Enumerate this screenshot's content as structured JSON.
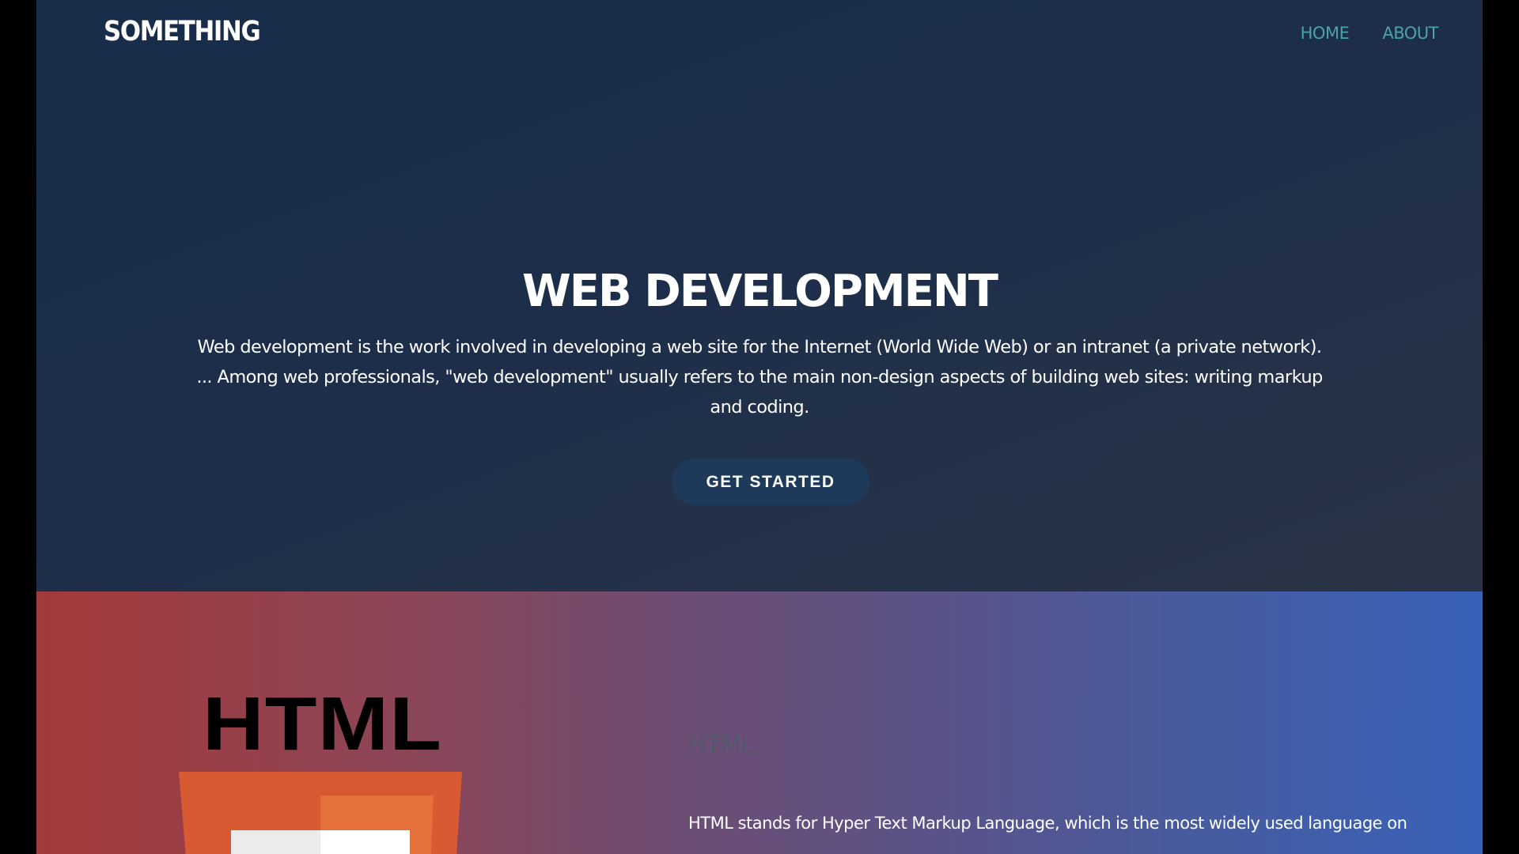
{
  "header": {
    "brand": "SOMETHING",
    "nav": [
      {
        "label": "HOME"
      },
      {
        "label": "ABOUT"
      }
    ]
  },
  "hero": {
    "title": "WEB DEVELOPMENT",
    "description": "Web development is the work involved in developing a web site for the Internet (World Wide Web) or an intranet (a private network). ... Among web professionals, \"web development\" usually refers to the main non-design aspects of building web sites: writing markup and coding.",
    "cta_label": "GET STARTED"
  },
  "html_section": {
    "logo_text": "HTML",
    "heading": "HTML",
    "text": "HTML stands for Hyper Text Markup Language, which is the most widely used language on"
  },
  "colors": {
    "hero_bg": "#1d2e4a",
    "nav_link": "#4aa3a6",
    "cta_bg": "#1d3a5a",
    "section_gradient_start": "#a33a3b",
    "section_gradient_end": "#3862b8",
    "html5_orange": "#e34f26",
    "html5_light_orange": "#ef652a"
  },
  "icons": {
    "html5_logo": "html5-shield-icon"
  }
}
